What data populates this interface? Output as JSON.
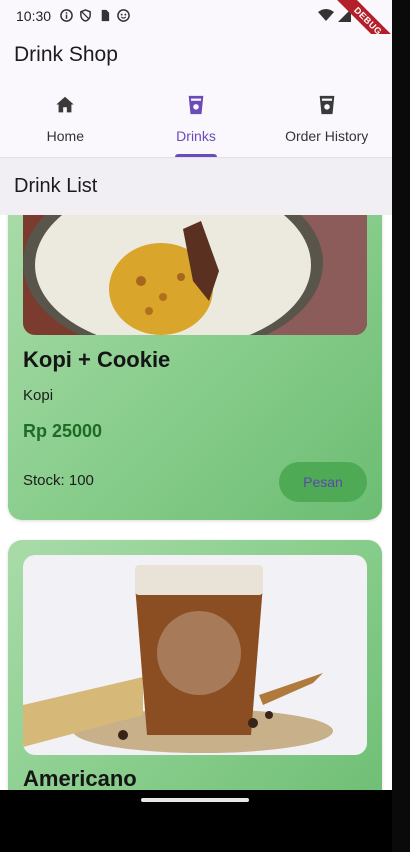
{
  "status_bar": {
    "time": "10:30",
    "debug_label": "DEBUG"
  },
  "app": {
    "title": "Drink Shop"
  },
  "tabs": [
    {
      "label": "Home",
      "icon": "home-icon"
    },
    {
      "label": "Drinks",
      "icon": "cup-icon",
      "active": true
    },
    {
      "label": "Order History",
      "icon": "cup-icon"
    }
  ],
  "section": {
    "title": "Drink List"
  },
  "products": [
    {
      "name": "Kopi + Cookie",
      "category": "Kopi",
      "price": "Rp 25000",
      "stock": "Stock: 100",
      "button": "Pesan",
      "image": "cookie-plate-photo"
    },
    {
      "name": "Americano",
      "image": "iced-coffee-photo"
    }
  ],
  "colors": {
    "accent": "#6a4cb8",
    "card_green": "#8ccf8f",
    "price_green": "#1f6b26",
    "button_green": "#4faa55"
  }
}
